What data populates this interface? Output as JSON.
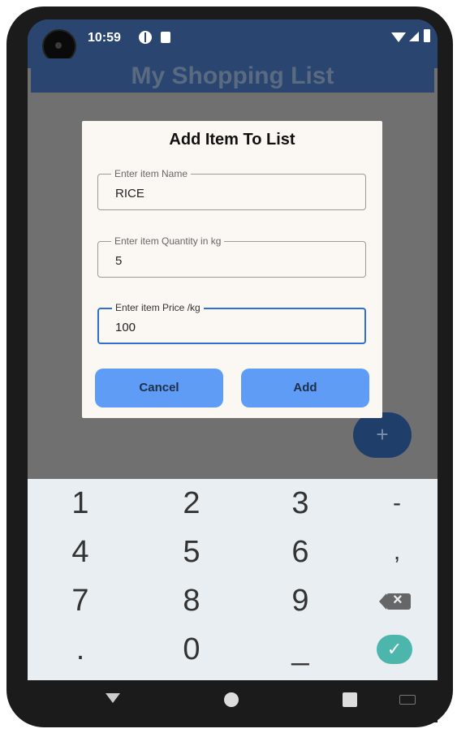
{
  "status_bar": {
    "time": "10:59"
  },
  "app_bar": {
    "title": "My Shopping List"
  },
  "dialog": {
    "title": "Add Item To List",
    "fields": [
      {
        "label": "Enter item Name",
        "value": "RICE"
      },
      {
        "label": "Enter item Quantity in kg",
        "value": "5"
      },
      {
        "label": "Enter item Price /kg",
        "value": "100"
      }
    ],
    "cancel_label": "Cancel",
    "add_label": "Add"
  },
  "fab": {
    "icon": "plus-icon",
    "label": "+"
  },
  "keyboard": {
    "keys": [
      "1",
      "2",
      "3",
      "-",
      "4",
      "5",
      "6",
      ",",
      "7",
      "8",
      "9",
      ".",
      "0",
      "_"
    ],
    "done_label": "✓",
    "accent_color": "#4db6ac"
  },
  "colors": {
    "app_bar": "#2a4670",
    "button": "#5e9cf6",
    "focus": "#2f6fd1"
  }
}
